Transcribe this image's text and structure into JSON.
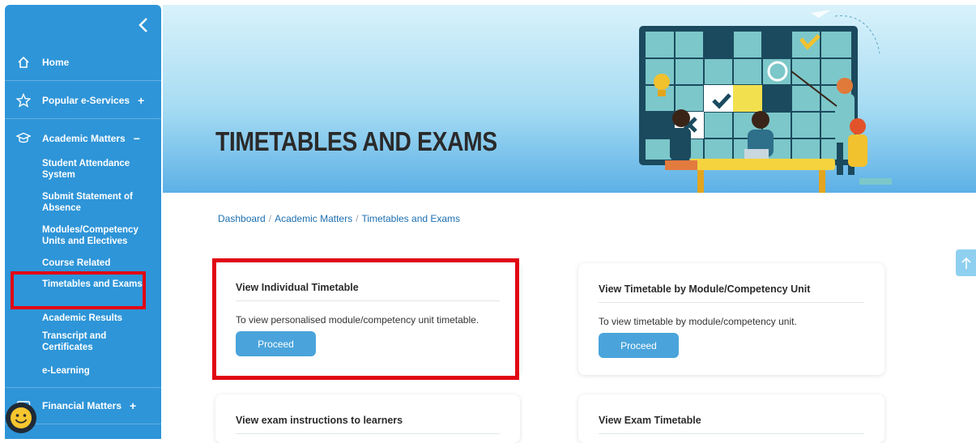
{
  "sidebar": {
    "items": [
      {
        "label": "Home",
        "icon": "home-icon"
      },
      {
        "label": "Popular e-Services",
        "toggle": "+",
        "icon": "star-icon"
      },
      {
        "label": "Academic Matters",
        "toggle": "−",
        "icon": "graduation-cap-icon"
      },
      {
        "label": "Financial Matters",
        "toggle": "+",
        "icon": "wallet-icon"
      }
    ],
    "sub_items": [
      {
        "label": "Student Attendance System"
      },
      {
        "label": "Submit Statement of Absence"
      },
      {
        "label": "Modules/Competency Units and Electives"
      },
      {
        "label": "Course Related"
      },
      {
        "label": "Timetables and Exams"
      },
      {
        "label": "Academic Results"
      },
      {
        "label": "Transcript and Certificates"
      },
      {
        "label": "e-Learning"
      }
    ]
  },
  "hero": {
    "title": "TIMETABLES AND EXAMS"
  },
  "breadcrumb": {
    "items": [
      "Dashboard",
      "Academic Matters",
      "Timetables and Exams"
    ],
    "separator": "/"
  },
  "cards": [
    {
      "title": "View Individual Timetable",
      "desc": "To view personalised module/competency unit timetable.",
      "button": "Proceed"
    },
    {
      "title": "View Timetable by Module/Competency Unit",
      "desc": "To view timetable by module/competency unit.",
      "button": "Proceed"
    },
    {
      "title": "View exam instructions to learners"
    },
    {
      "title": "View Exam Timetable"
    }
  ],
  "colors": {
    "sidebar": "#2e95d8",
    "accent": "#4aa4db",
    "highlight": "#e10613"
  }
}
